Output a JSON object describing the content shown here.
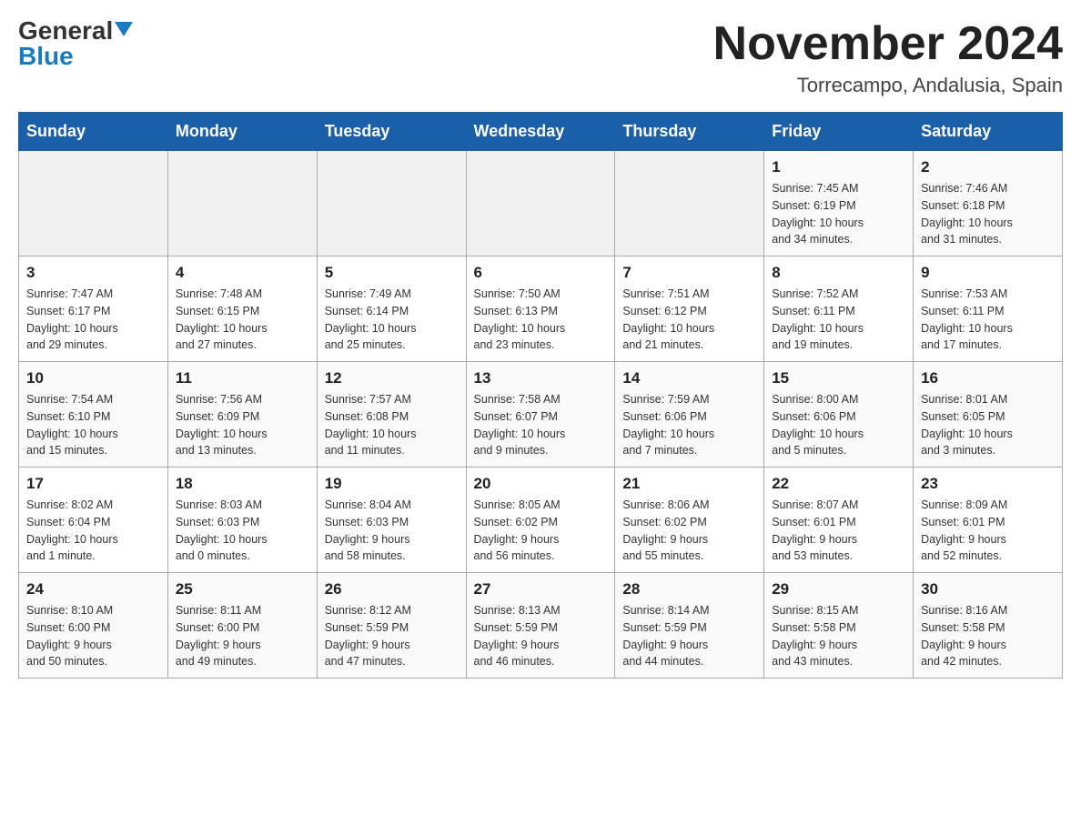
{
  "header": {
    "logo_general": "General",
    "logo_blue": "Blue",
    "title": "November 2024",
    "subtitle": "Torrecampo, Andalusia, Spain"
  },
  "weekdays": [
    "Sunday",
    "Monday",
    "Tuesday",
    "Wednesday",
    "Thursday",
    "Friday",
    "Saturday"
  ],
  "weeks": [
    [
      {
        "day": "",
        "info": ""
      },
      {
        "day": "",
        "info": ""
      },
      {
        "day": "",
        "info": ""
      },
      {
        "day": "",
        "info": ""
      },
      {
        "day": "",
        "info": ""
      },
      {
        "day": "1",
        "info": "Sunrise: 7:45 AM\nSunset: 6:19 PM\nDaylight: 10 hours\nand 34 minutes."
      },
      {
        "day": "2",
        "info": "Sunrise: 7:46 AM\nSunset: 6:18 PM\nDaylight: 10 hours\nand 31 minutes."
      }
    ],
    [
      {
        "day": "3",
        "info": "Sunrise: 7:47 AM\nSunset: 6:17 PM\nDaylight: 10 hours\nand 29 minutes."
      },
      {
        "day": "4",
        "info": "Sunrise: 7:48 AM\nSunset: 6:15 PM\nDaylight: 10 hours\nand 27 minutes."
      },
      {
        "day": "5",
        "info": "Sunrise: 7:49 AM\nSunset: 6:14 PM\nDaylight: 10 hours\nand 25 minutes."
      },
      {
        "day": "6",
        "info": "Sunrise: 7:50 AM\nSunset: 6:13 PM\nDaylight: 10 hours\nand 23 minutes."
      },
      {
        "day": "7",
        "info": "Sunrise: 7:51 AM\nSunset: 6:12 PM\nDaylight: 10 hours\nand 21 minutes."
      },
      {
        "day": "8",
        "info": "Sunrise: 7:52 AM\nSunset: 6:11 PM\nDaylight: 10 hours\nand 19 minutes."
      },
      {
        "day": "9",
        "info": "Sunrise: 7:53 AM\nSunset: 6:11 PM\nDaylight: 10 hours\nand 17 minutes."
      }
    ],
    [
      {
        "day": "10",
        "info": "Sunrise: 7:54 AM\nSunset: 6:10 PM\nDaylight: 10 hours\nand 15 minutes."
      },
      {
        "day": "11",
        "info": "Sunrise: 7:56 AM\nSunset: 6:09 PM\nDaylight: 10 hours\nand 13 minutes."
      },
      {
        "day": "12",
        "info": "Sunrise: 7:57 AM\nSunset: 6:08 PM\nDaylight: 10 hours\nand 11 minutes."
      },
      {
        "day": "13",
        "info": "Sunrise: 7:58 AM\nSunset: 6:07 PM\nDaylight: 10 hours\nand 9 minutes."
      },
      {
        "day": "14",
        "info": "Sunrise: 7:59 AM\nSunset: 6:06 PM\nDaylight: 10 hours\nand 7 minutes."
      },
      {
        "day": "15",
        "info": "Sunrise: 8:00 AM\nSunset: 6:06 PM\nDaylight: 10 hours\nand 5 minutes."
      },
      {
        "day": "16",
        "info": "Sunrise: 8:01 AM\nSunset: 6:05 PM\nDaylight: 10 hours\nand 3 minutes."
      }
    ],
    [
      {
        "day": "17",
        "info": "Sunrise: 8:02 AM\nSunset: 6:04 PM\nDaylight: 10 hours\nand 1 minute."
      },
      {
        "day": "18",
        "info": "Sunrise: 8:03 AM\nSunset: 6:03 PM\nDaylight: 10 hours\nand 0 minutes."
      },
      {
        "day": "19",
        "info": "Sunrise: 8:04 AM\nSunset: 6:03 PM\nDaylight: 9 hours\nand 58 minutes."
      },
      {
        "day": "20",
        "info": "Sunrise: 8:05 AM\nSunset: 6:02 PM\nDaylight: 9 hours\nand 56 minutes."
      },
      {
        "day": "21",
        "info": "Sunrise: 8:06 AM\nSunset: 6:02 PM\nDaylight: 9 hours\nand 55 minutes."
      },
      {
        "day": "22",
        "info": "Sunrise: 8:07 AM\nSunset: 6:01 PM\nDaylight: 9 hours\nand 53 minutes."
      },
      {
        "day": "23",
        "info": "Sunrise: 8:09 AM\nSunset: 6:01 PM\nDaylight: 9 hours\nand 52 minutes."
      }
    ],
    [
      {
        "day": "24",
        "info": "Sunrise: 8:10 AM\nSunset: 6:00 PM\nDaylight: 9 hours\nand 50 minutes."
      },
      {
        "day": "25",
        "info": "Sunrise: 8:11 AM\nSunset: 6:00 PM\nDaylight: 9 hours\nand 49 minutes."
      },
      {
        "day": "26",
        "info": "Sunrise: 8:12 AM\nSunset: 5:59 PM\nDaylight: 9 hours\nand 47 minutes."
      },
      {
        "day": "27",
        "info": "Sunrise: 8:13 AM\nSunset: 5:59 PM\nDaylight: 9 hours\nand 46 minutes."
      },
      {
        "day": "28",
        "info": "Sunrise: 8:14 AM\nSunset: 5:59 PM\nDaylight: 9 hours\nand 44 minutes."
      },
      {
        "day": "29",
        "info": "Sunrise: 8:15 AM\nSunset: 5:58 PM\nDaylight: 9 hours\nand 43 minutes."
      },
      {
        "day": "30",
        "info": "Sunrise: 8:16 AM\nSunset: 5:58 PM\nDaylight: 9 hours\nand 42 minutes."
      }
    ]
  ]
}
